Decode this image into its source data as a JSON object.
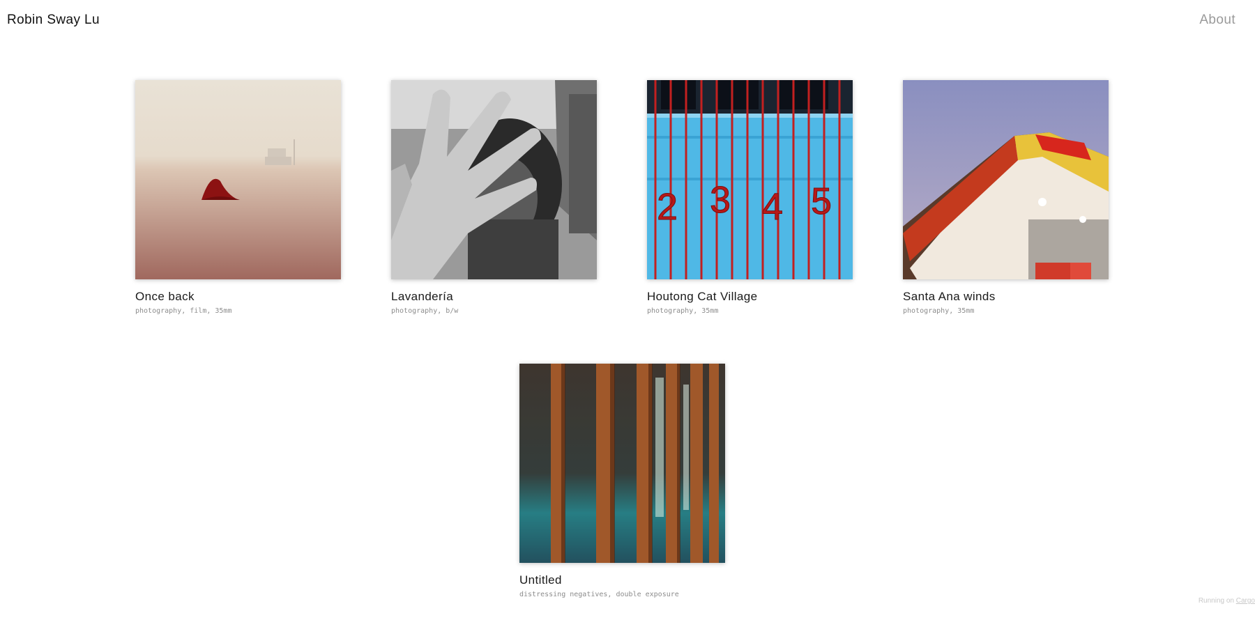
{
  "header": {
    "site_title": "Robin Sway Lu",
    "about_label": "About"
  },
  "projects": [
    {
      "title": "Once back",
      "tags": "photography, film, 35mm"
    },
    {
      "title": "Lavandería",
      "tags": "photography, b/w"
    },
    {
      "title": "Houtong Cat Village",
      "tags": "photography, 35mm",
      "photo_numbers": [
        "2",
        "3",
        "4",
        "5"
      ]
    },
    {
      "title": "Santa Ana winds",
      "tags": "photography, 35mm"
    },
    {
      "title": "Untitled",
      "tags": "distressing negatives, double exposure"
    }
  ],
  "footer": {
    "running_on": "Running on",
    "cargo": "Cargo"
  }
}
